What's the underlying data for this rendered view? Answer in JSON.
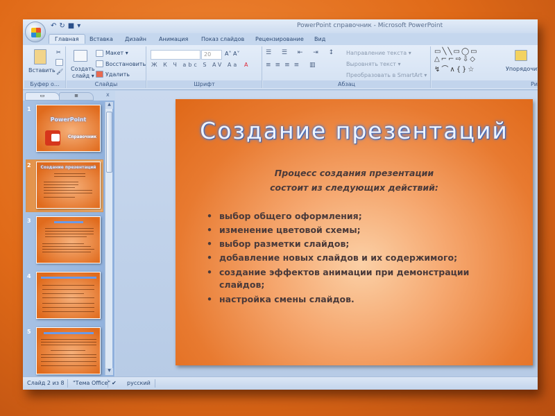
{
  "window": {
    "title": "PowerPoint справочник - Microsoft PowerPoint"
  },
  "tabs": [
    "Главная",
    "Вставка",
    "Дизайн",
    "Анимация",
    "Показ слайдов",
    "Рецензирование",
    "Вид"
  ],
  "ribbon": {
    "clipboard": {
      "paste": "Вставить",
      "label": "Буфер о..."
    },
    "slides": {
      "new_slide_1": "Создать",
      "new_slide_2": "слайд ▾",
      "layout": "Макет ▾",
      "reset": "Восстановить",
      "delete": "Удалить",
      "label": "Слайды"
    },
    "font": {
      "font_name": "",
      "font_size": "20",
      "label": "Шрифт",
      "buttons": "Ж К Ч abc S AV Aa"
    },
    "paragraph": {
      "text_direction": "Направление текста ▾",
      "align_text": "Выровнять текст ▾",
      "smartart": "Преобразовать в SmartArt ▾",
      "label": "Абзац"
    },
    "drawing": {
      "arrange": "Упорядочить",
      "label": "Ри"
    }
  },
  "thumbnails": [
    {
      "num": "1",
      "title": "PowerPoint",
      "subtitle": "Справочник"
    },
    {
      "num": "2",
      "title": "Создание презентаций",
      "selected": true
    },
    {
      "num": "3"
    },
    {
      "num": "4"
    },
    {
      "num": "5"
    }
  ],
  "slide": {
    "title": "Создание презентаций",
    "subtitle_lines": [
      "Процесс создания презентации",
      "состоит из следующих действий:"
    ],
    "bullets": [
      "выбор общего оформления;",
      "изменение цветовой схемы;",
      "выбор разметки слайдов;",
      "добавление новых слайдов и их содержимого;",
      "создание эффектов анимации при демонстрации слайдов;",
      "настройка смены слайдов."
    ]
  },
  "status": {
    "slide": "Слайд 2 из 8",
    "theme": "\"Тема Office\"",
    "language": "русский"
  },
  "colors": {
    "background": "#e06a18",
    "ribbon": "#d2e0f2",
    "slide": "#e87a30"
  }
}
